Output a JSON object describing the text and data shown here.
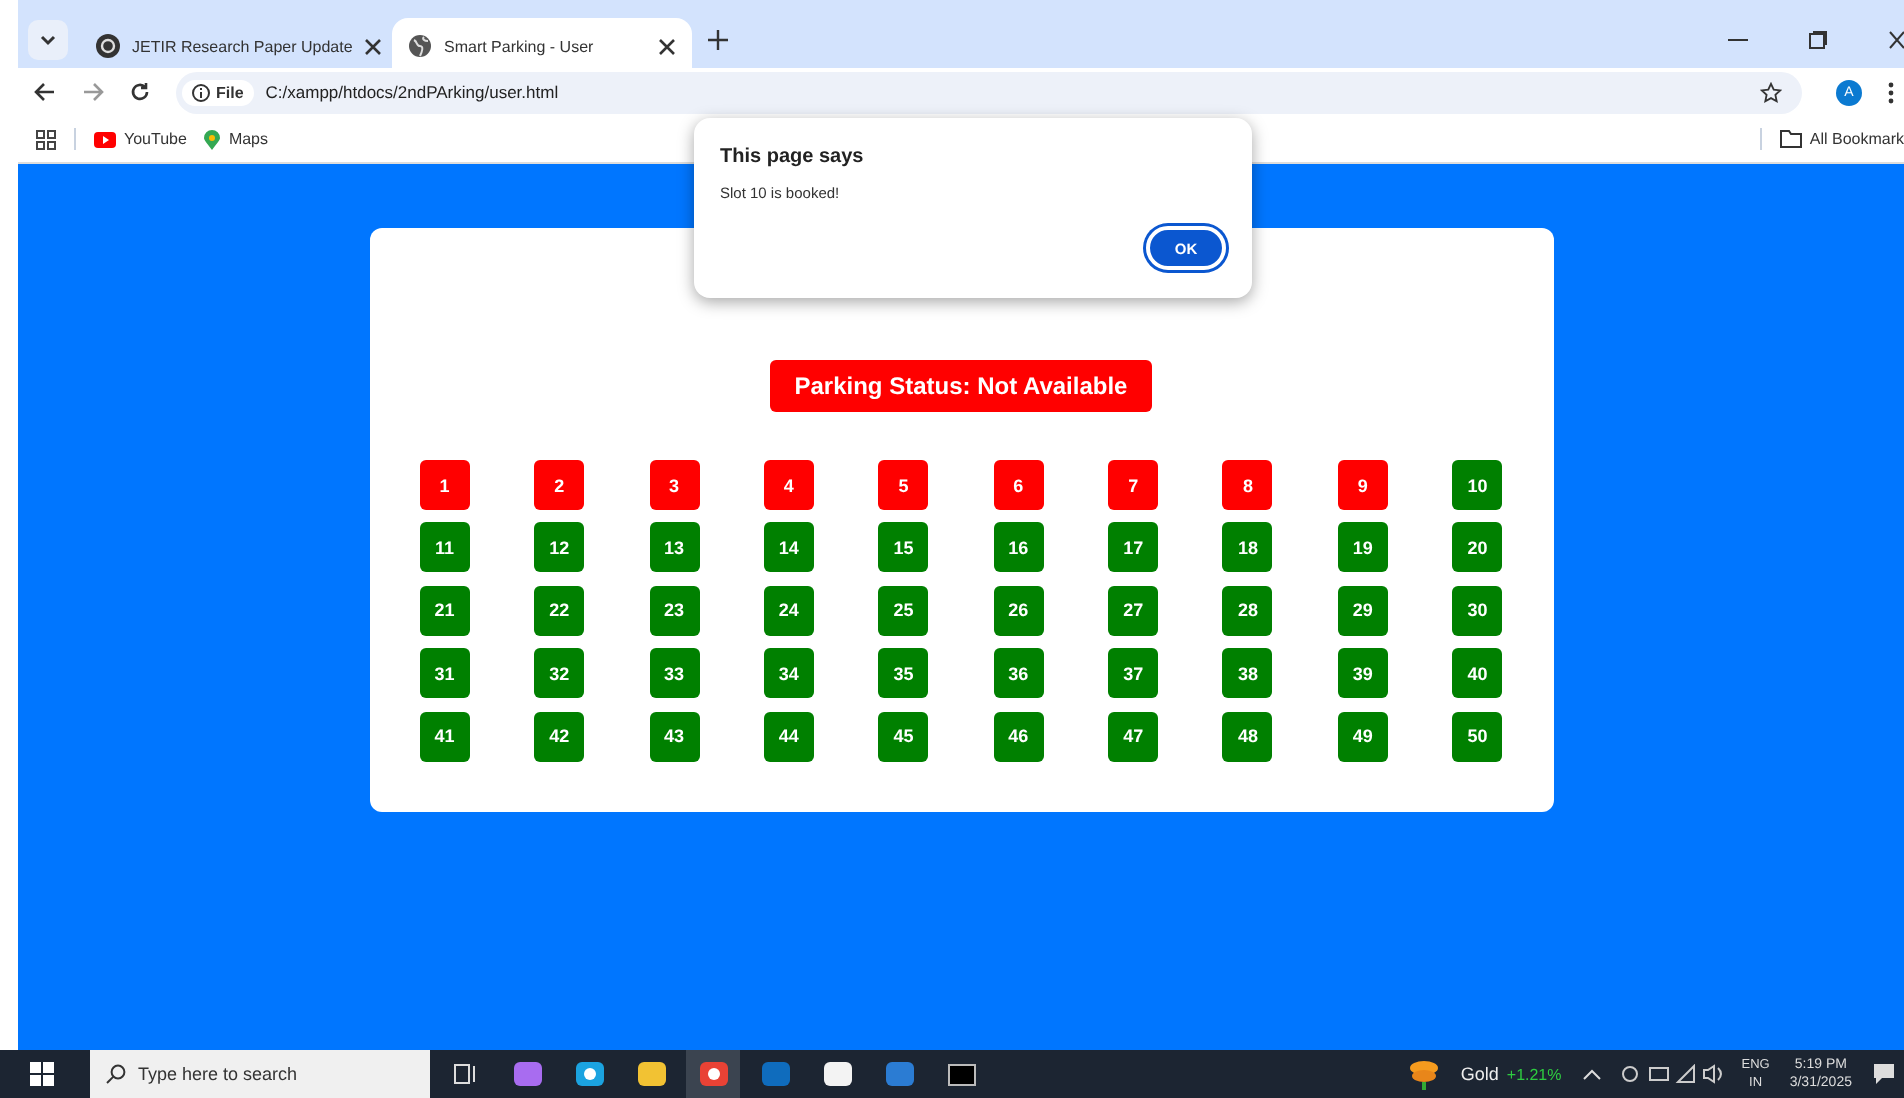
{
  "tabs": [
    {
      "title": "JETIR Research Paper Update",
      "selected": false,
      "kind": "logo"
    },
    {
      "title": "Smart Parking - User",
      "selected": true,
      "kind": "globe"
    }
  ],
  "address_bar": {
    "scheme": "File",
    "url": "C:/xampp/htdocs/2ndPArking/user.html"
  },
  "profile": "A",
  "bookmarks": [
    {
      "label": "YouTube",
      "kind": "youtube"
    },
    {
      "label": "Maps",
      "kind": "maps"
    }
  ],
  "all_bookmarks": "All Bookmark",
  "page": {
    "status": "Parking Status: Not Available",
    "slots": [
      {
        "label": "1",
        "booked": true
      },
      {
        "label": "2",
        "booked": true
      },
      {
        "label": "3",
        "booked": true
      },
      {
        "label": "4",
        "booked": true
      },
      {
        "label": "5",
        "booked": true
      },
      {
        "label": "6",
        "booked": true
      },
      {
        "label": "7",
        "booked": true
      },
      {
        "label": "8",
        "booked": true
      },
      {
        "label": "9",
        "booked": true
      },
      {
        "label": "10",
        "booked": false
      },
      {
        "label": "11",
        "booked": false
      },
      {
        "label": "12",
        "booked": false
      },
      {
        "label": "13",
        "booked": false
      },
      {
        "label": "14",
        "booked": false
      },
      {
        "label": "15",
        "booked": false
      },
      {
        "label": "16",
        "booked": false
      },
      {
        "label": "17",
        "booked": false
      },
      {
        "label": "18",
        "booked": false
      },
      {
        "label": "19",
        "booked": false
      },
      {
        "label": "20",
        "booked": false
      },
      {
        "label": "21",
        "booked": false
      },
      {
        "label": "22",
        "booked": false
      },
      {
        "label": "23",
        "booked": false
      },
      {
        "label": "24",
        "booked": false
      },
      {
        "label": "25",
        "booked": false
      },
      {
        "label": "26",
        "booked": false
      },
      {
        "label": "27",
        "booked": false
      },
      {
        "label": "28",
        "booked": false
      },
      {
        "label": "29",
        "booked": false
      },
      {
        "label": "30",
        "booked": false
      },
      {
        "label": "31",
        "booked": false
      },
      {
        "label": "32",
        "booked": false
      },
      {
        "label": "33",
        "booked": false
      },
      {
        "label": "34",
        "booked": false
      },
      {
        "label": "35",
        "booked": false
      },
      {
        "label": "36",
        "booked": false
      },
      {
        "label": "37",
        "booked": false
      },
      {
        "label": "38",
        "booked": false
      },
      {
        "label": "39",
        "booked": false
      },
      {
        "label": "40",
        "booked": false
      },
      {
        "label": "41",
        "booked": false
      },
      {
        "label": "42",
        "booked": false
      },
      {
        "label": "43",
        "booked": false
      },
      {
        "label": "44",
        "booked": false
      },
      {
        "label": "45",
        "booked": false
      },
      {
        "label": "46",
        "booked": false
      },
      {
        "label": "47",
        "booked": false
      },
      {
        "label": "48",
        "booked": false
      },
      {
        "label": "49",
        "booked": false
      },
      {
        "label": "50",
        "booked": false
      }
    ]
  },
  "dialog": {
    "title": "This page says",
    "message": "Slot 10 is booked!",
    "button": "OK"
  },
  "taskbar": {
    "search_placeholder": "Type here to search",
    "apps": [
      {
        "kind": "taskview",
        "active": false
      },
      {
        "kind": "copilot",
        "active": false
      },
      {
        "kind": "edge",
        "active": false
      },
      {
        "kind": "folder",
        "active": false
      },
      {
        "kind": "chrome",
        "active": true
      },
      {
        "kind": "outlook",
        "active": false
      },
      {
        "kind": "store",
        "active": false
      },
      {
        "kind": "word",
        "active": false
      },
      {
        "kind": "terminal",
        "active": false
      }
    ],
    "ticker": {
      "name": "Gold",
      "change": "+1.21%"
    },
    "language": [
      "ENG",
      "IN"
    ],
    "time": "5:19 PM",
    "date": "3/31/2025"
  }
}
